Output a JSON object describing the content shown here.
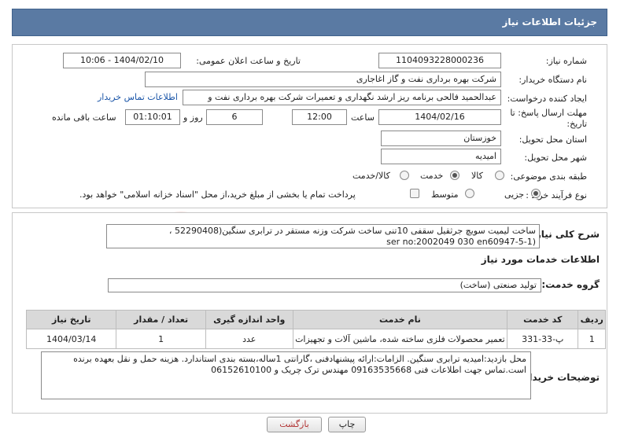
{
  "header": {
    "title": "جزئیات اطلاعات نیاز"
  },
  "form": {
    "need_number_label": "شماره نیاز:",
    "need_number": "1104093228000236",
    "announce_label": "تاریخ و ساعت اعلان عمومی:",
    "announce_value": "1404/02/10 - 10:06",
    "buyer_org_label": "نام دستگاه خریدار:",
    "buyer_org": "شرکت بهره برداری نفت و گاز اغاجاری",
    "creator_label": "ایجاد کننده درخواست:",
    "creator": "عبدالحمید فالحی برنامه ریز ارشد نگهداری و تعمیرات شرکت بهره برداری نفت و",
    "contact_link": "اطلاعات تماس خریدار",
    "deadline_label": "مهلت ارسال پاسخ: تا تاریخ:",
    "deadline_date": "1404/02/16",
    "time_label": "ساعت",
    "deadline_time": "12:00",
    "days": "6",
    "days_label": "روز و",
    "remaining_time": "01:10:01",
    "remaining_label": "ساعت باقی مانده",
    "province_label": "استان محل تحویل:",
    "province": "خوزستان",
    "city_label": "شهر محل تحویل:",
    "city": "امیدیه",
    "category_label": "طبقه بندی موضوعی:",
    "category_options": [
      "کالا",
      "خدمت",
      "کالا/خدمت"
    ],
    "category_selected": "خدمت",
    "process_label": "نوع فرآیند خرید :",
    "process_options": [
      "جزیی",
      "متوسط"
    ],
    "process_selected": "جزیی",
    "payment_note": "پرداخت تمام یا بخشی از مبلغ خرید،از محل \"اسناد خزانه اسلامی\" خواهد بود."
  },
  "details": {
    "summary_label": "شرح کلی نیاز:",
    "summary_line1": "ساخت لیمیت سویچ جرثقیل سقفی 10تنی ساخت شرکت وزنه مستقر در ترابری سنگین(52290408 ،",
    "summary_line2": "ser no:2002049 030              en60947-5-1)",
    "services_heading": "اطلاعات خدمات مورد نیاز",
    "service_group_label": "گروه خدمت:",
    "service_group": "تولید صنعتی (ساخت)",
    "table": {
      "headers": [
        "ردیف",
        "کد خدمت",
        "نام خدمت",
        "واحد اندازه گیری",
        "تعداد / مقدار",
        "تاریخ نیاز"
      ],
      "rows": [
        [
          "1",
          "پ-33-331",
          "تعمیر محصولات فلزی ساخته شده، ماشین آلات و تجهیزات",
          "عدد",
          "1",
          "1404/03/14"
        ]
      ]
    },
    "buyer_notes_label": "توضیحات خریدار:",
    "buyer_notes": "محل بازدید:امیدیه ترابری سنگین. الزامات:ارائه پیشنهادفنی ،گارانتی 1ساله،بسته بندی استاندارد. هزینه حمل و نقل بعهده برنده است.تماس جهت اطلاعات فنی 09163535668 مهندس ترک چریک و 06152610100"
  },
  "buttons": {
    "print": "چاپ",
    "back": "بازگشت"
  },
  "watermark": {
    "text": "AriaTender.neT"
  },
  "colors": {
    "header_bg": "#5a7aa3",
    "link": "#1a55a8"
  }
}
